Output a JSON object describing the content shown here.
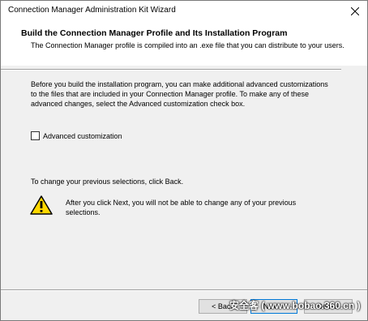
{
  "window": {
    "title": "Connection Manager Administration Kit Wizard"
  },
  "header": {
    "title": "Build the Connection Manager Profile and Its Installation Program",
    "description": "The Connection Manager profile is compiled into an .exe file that you can distribute to your users."
  },
  "body": {
    "intro": "Before you build the installation program, you can make additional advanced customizations to the files that are included in your Connection Manager profile. To make any of these advanced changes, select the Advanced customization check box.",
    "checkbox_label": "Advanced customization",
    "checkbox_checked": false,
    "back_info": "To change your previous selections, click Back.",
    "warning": "After you click Next, you will not be able to change any of your previous selections."
  },
  "footer": {
    "back_label": "< Back",
    "next_label": "Next >",
    "cancel_label": "Cancel",
    "watermark": "安全客 ( www.bobao.360.cn )"
  },
  "colors": {
    "warning_fill": "#ffd800",
    "focus_border": "#0078d7"
  }
}
